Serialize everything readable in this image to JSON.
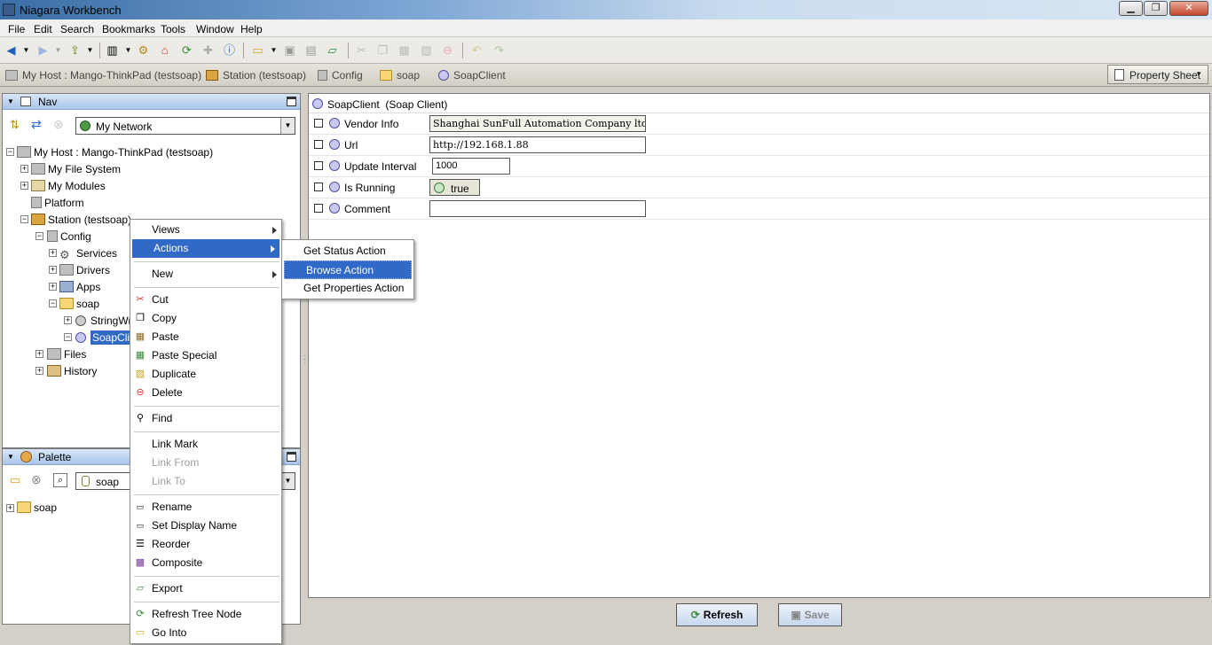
{
  "window": {
    "title": "Niagara Workbench",
    "minimize": "▁",
    "maximize": "❐",
    "close": "✕"
  },
  "menubar": [
    "File",
    "Edit",
    "Search",
    "Bookmarks",
    "Tools",
    "Window",
    "Help"
  ],
  "locator": {
    "items": [
      "My Host : Mango-ThinkPad (testsoap)",
      "Station (testsoap)",
      "Config",
      "soap",
      "SoapClient"
    ],
    "view_selector": "Property Sheet"
  },
  "nav": {
    "title": "Nav",
    "network_select": "My Network",
    "tree": [
      {
        "label": "My Host : Mango-ThinkPad (testsoap)"
      },
      {
        "label": "My File System"
      },
      {
        "label": "My Modules"
      },
      {
        "label": "Platform"
      },
      {
        "label": "Station (testsoap)"
      },
      {
        "label": "Config"
      },
      {
        "label": "Services"
      },
      {
        "label": "Drivers"
      },
      {
        "label": "Apps"
      },
      {
        "label": "soap"
      },
      {
        "label": "StringWr"
      },
      {
        "label": "SoapClie"
      },
      {
        "label": "Files"
      },
      {
        "label": "History"
      }
    ]
  },
  "palette": {
    "title": "Palette",
    "module_select": "soap",
    "tree": [
      {
        "label": "soap"
      }
    ]
  },
  "context_menu": {
    "items": [
      {
        "label": "Views"
      },
      {
        "label": "Actions"
      },
      {
        "label": "New"
      },
      {
        "label": "Cut"
      },
      {
        "label": "Copy"
      },
      {
        "label": "Paste"
      },
      {
        "label": "Paste Special"
      },
      {
        "label": "Duplicate"
      },
      {
        "label": "Delete"
      },
      {
        "label": "Find"
      },
      {
        "label": "Link Mark"
      },
      {
        "label": "Link From"
      },
      {
        "label": "Link To"
      },
      {
        "label": "Rename"
      },
      {
        "label": "Set Display Name"
      },
      {
        "label": "Reorder"
      },
      {
        "label": "Composite"
      },
      {
        "label": "Export"
      },
      {
        "label": "Refresh Tree Node"
      },
      {
        "label": "Go Into"
      }
    ]
  },
  "actions_submenu": {
    "items": [
      {
        "label": "Get Status Action"
      },
      {
        "label": "Browse Action"
      },
      {
        "label": "Get Properties Action"
      }
    ]
  },
  "property_sheet": {
    "header": "SoapClient  (Soap Client)",
    "rows": [
      {
        "label": "Vendor Info",
        "value": "Shanghai SunFull Automation Company ltd."
      },
      {
        "label": "Url",
        "value": "http://192.168.1.88"
      },
      {
        "label": "Update Interval",
        "value": "1000"
      },
      {
        "label": "Is Running",
        "value": "true"
      },
      {
        "label": "Comment",
        "value": ""
      }
    ]
  },
  "buttons": {
    "refresh": "Refresh",
    "save": "Save"
  },
  "colors": {
    "selection": "#3169c6",
    "panel_header": "#a9c5ea"
  }
}
